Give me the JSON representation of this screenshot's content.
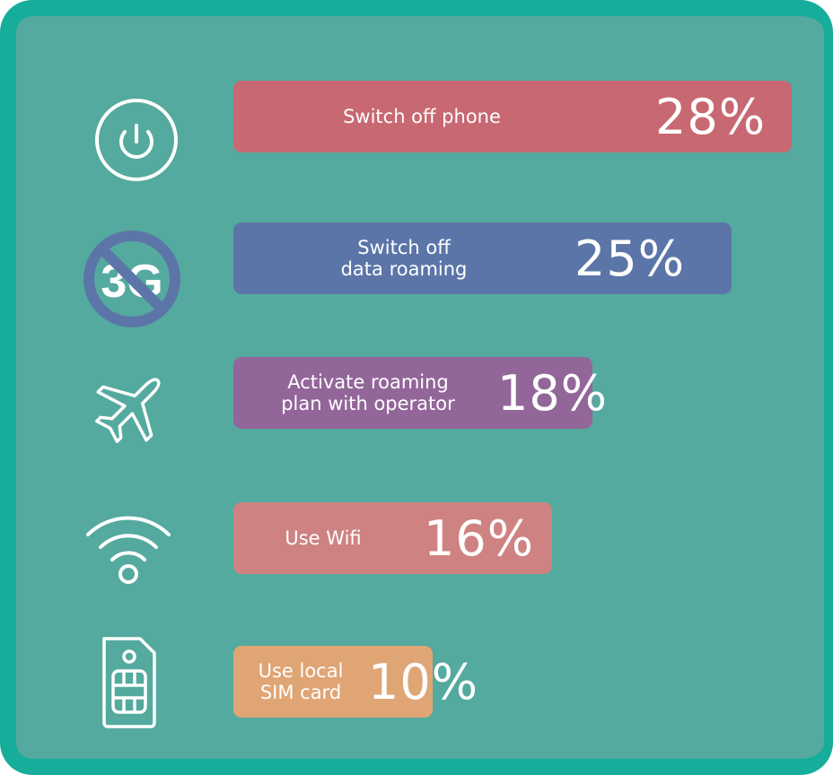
{
  "chart_data": {
    "type": "bar",
    "orientation": "horizontal",
    "unit": "%",
    "categories": [
      "Switch off phone",
      "Switch off\ndata roaming",
      "Activate roaming\nplan with operator",
      "Use Wifi",
      "Use local\nSIM card"
    ],
    "values": [
      28,
      25,
      18,
      16,
      10
    ],
    "value_labels": [
      "28%",
      "25%",
      "18%",
      "16%",
      "10%"
    ],
    "bar_colors": [
      "#c86872",
      "#5c75a8",
      "#93669a",
      "#cf8282",
      "#e0a575"
    ],
    "icons": [
      "power-icon",
      "no-3g-icon",
      "airplane-icon",
      "wifi-icon",
      "sim-card-icon"
    ],
    "icon_text": {
      "no_3g": "3G"
    },
    "grid": false,
    "legend": "none"
  },
  "colors": {
    "background": "#54aa9e",
    "border": "#17ad9b",
    "icon_stroke": "#ffffff",
    "forbidden_sign": "#5c75a8"
  }
}
